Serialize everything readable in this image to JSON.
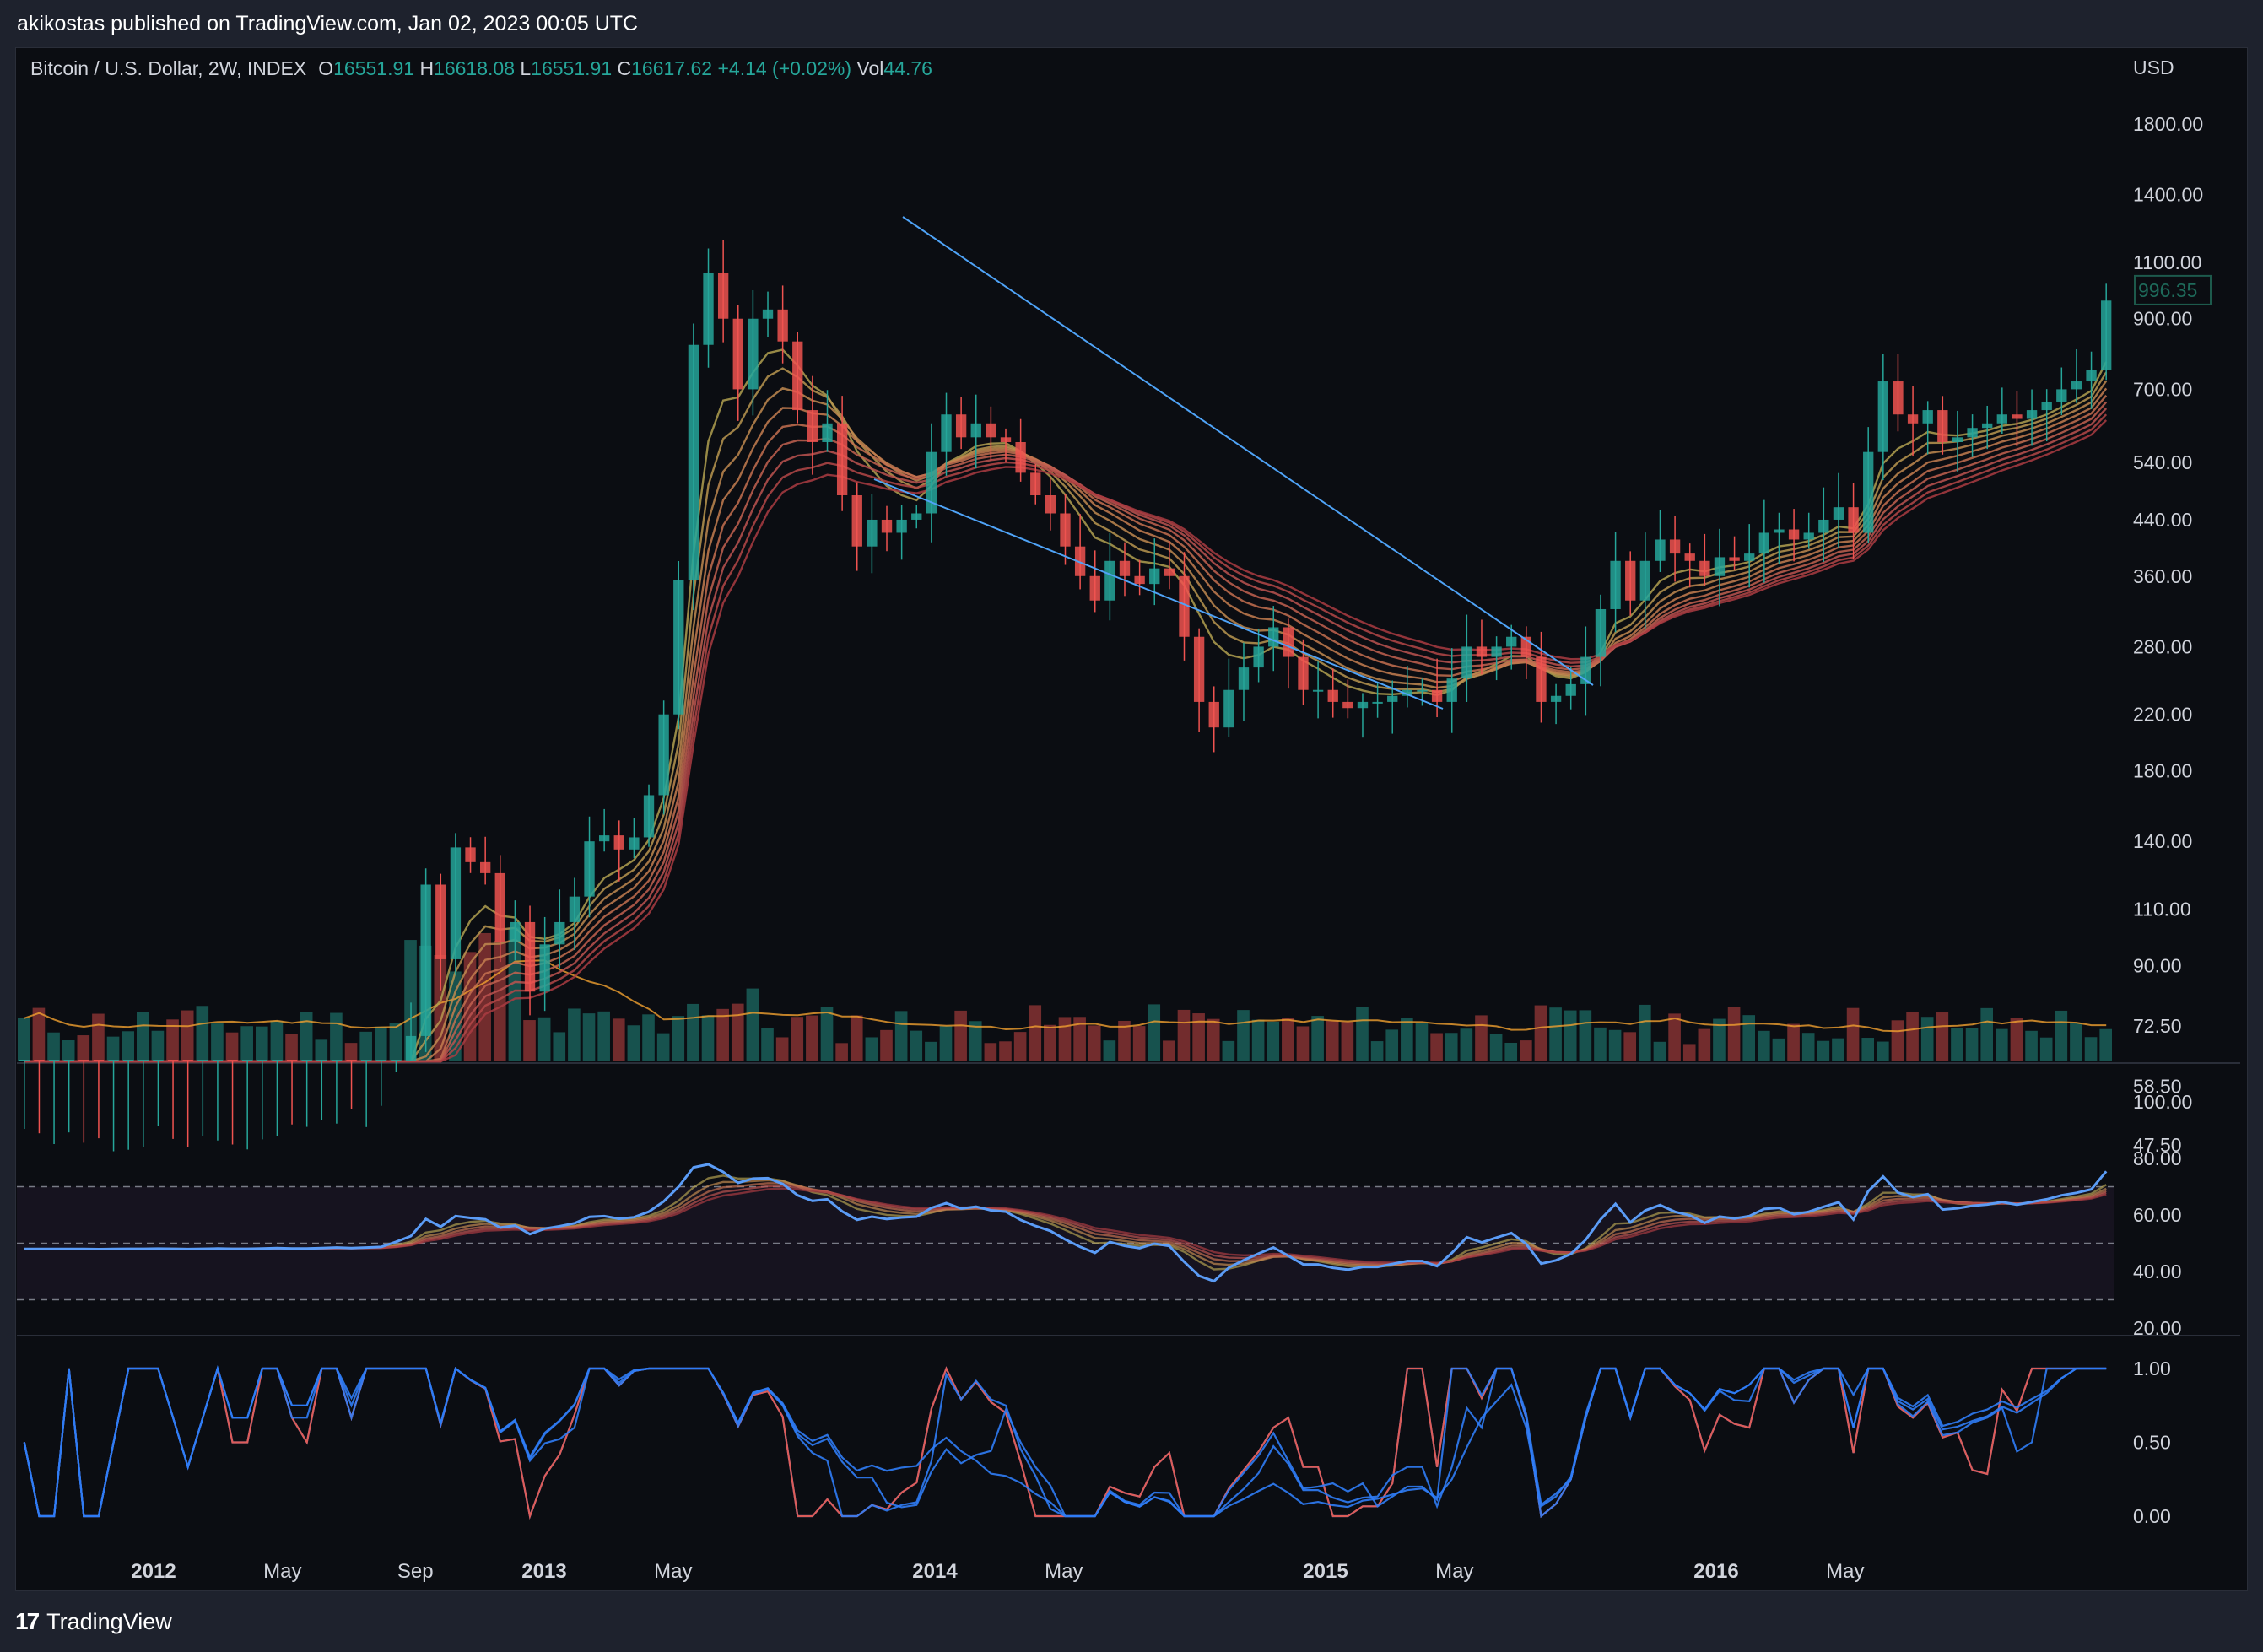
{
  "header": {
    "publish_text": "akikostas published on TradingView.com, Jan 02, 2023 00:05 UTC"
  },
  "legend": {
    "symbol": "Bitcoin / U.S. Dollar, 2W, INDEX",
    "o_label": "O",
    "o_value": "16551.91",
    "h_label": "H",
    "h_value": "16618.08",
    "l_label": "L",
    "l_value": "16551.91",
    "c_label": "C",
    "c_value": "16617.62",
    "change": "+4.14 (+0.02%)",
    "vol_label": "Vol",
    "vol_value": "44.76"
  },
  "colors": {
    "up": "#26a69a",
    "down": "#ef5350",
    "trendline": "#4fa3f7",
    "rsi": "#5b9cf6",
    "stoch_k": "#2f7cf6",
    "stoch_d": "#f05a4a",
    "background": "#0b0d12"
  },
  "footer": {
    "logo_glyph": "17",
    "brand": "TradingView"
  },
  "chart_data": [
    {
      "type": "candlestick",
      "currency": "USD",
      "scale": "log",
      "y_ticks": [
        "1800.00",
        "1400.00",
        "1100.00",
        "900.00",
        "700.00",
        "540.00",
        "440.00",
        "360.00",
        "280.00",
        "220.00",
        "180.00",
        "140.00",
        "110.00",
        "90.00",
        "72.50",
        "58.50",
        "47.50"
      ],
      "last_price_label": "996.35",
      "x_ticks": [
        {
          "label": "2012",
          "t": 2012.0,
          "bold": true
        },
        {
          "label": "May",
          "t": 2012.33
        },
        {
          "label": "Sep",
          "t": 2012.67
        },
        {
          "label": "2013",
          "t": 2013.0,
          "bold": true
        },
        {
          "label": "May",
          "t": 2013.33
        },
        {
          "label": "2014",
          "t": 2014.0,
          "bold": true
        },
        {
          "label": "May",
          "t": 2014.33
        },
        {
          "label": "2015",
          "t": 2015.0,
          "bold": true
        },
        {
          "label": "May",
          "t": 2015.33
        },
        {
          "label": "2016",
          "t": 2016.0,
          "bold": true
        },
        {
          "label": "May",
          "t": 2016.33
        }
      ],
      "closes": [
        45,
        44,
        44,
        45,
        44,
        43,
        44,
        45,
        45,
        46,
        45,
        44,
        45,
        46,
        45,
        45,
        46,
        47,
        46,
        46,
        47,
        48,
        47,
        48,
        49,
        58,
        70,
        120,
        92,
        137,
        130,
        125,
        98,
        105,
        82,
        97,
        105,
        115,
        140,
        143,
        136,
        142,
        165,
        220,
        355,
        820,
        1060,
        900,
        700,
        900,
        930,
        830,
        650,
        580,
        620,
        480,
        400,
        440,
        420,
        440,
        450,
        560,
        640,
        590,
        620,
        590,
        580,
        520,
        480,
        450,
        400,
        360,
        330,
        380,
        360,
        350,
        370,
        360,
        290,
        230,
        210,
        240,
        260,
        280,
        300,
        270,
        240,
        240,
        230,
        225,
        230,
        230,
        235,
        240,
        240,
        230,
        250,
        280,
        270,
        280,
        290,
        270,
        230,
        235,
        245,
        270,
        320,
        380,
        330,
        380,
        410,
        390,
        380,
        360,
        385,
        380,
        390,
        420,
        425,
        410,
        420,
        440,
        460,
        420,
        560,
        720,
        640,
        620,
        650,
        580,
        590,
        610,
        620,
        640,
        630,
        650,
        670,
        700,
        720,
        750,
        960
      ]
    },
    {
      "type": "line",
      "name": "RSI",
      "y_ticks": [
        "100.00",
        "80.00",
        "60.00",
        "40.00",
        "20.00"
      ],
      "bands": [
        70,
        50,
        30
      ],
      "ylim": [
        20,
        100
      ]
    },
    {
      "type": "line",
      "name": "Stochastic",
      "y_ticks": [
        "1.00",
        "0.50",
        "0.00"
      ],
      "ylim": [
        0,
        1
      ]
    }
  ]
}
